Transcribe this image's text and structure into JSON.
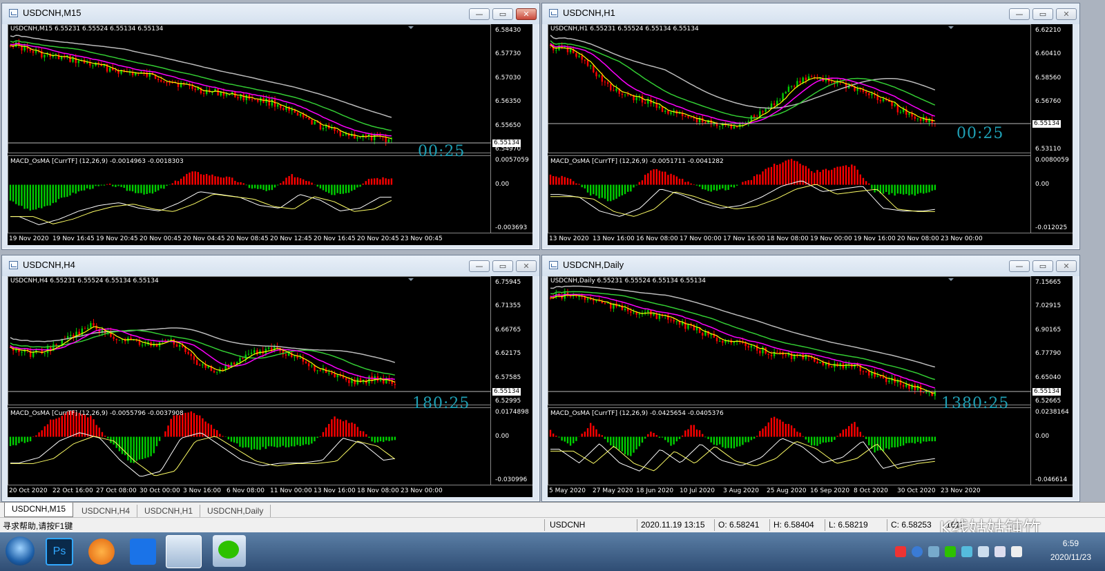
{
  "windows": [
    {
      "id": "m15",
      "title": "USDCNH,M15",
      "info": "USDCNH,M15  6.55231 6.55524 6.55134 6.55134",
      "price_labels": [
        "6.58430",
        "6.57730",
        "6.57030",
        "6.56350",
        "6.55650",
        "6.54970"
      ],
      "current_price": "6.55134",
      "timer": "00:25",
      "indicator_info": "MACD_OsMA [CurrTF] (12,26,9) -0.0014963 -0.0018303",
      "indicator_labels": [
        "0.0057059",
        "0.00",
        "-0.003693"
      ],
      "time_labels": [
        "19 Nov 2020",
        "19 Nov 16:45",
        "19 Nov 20:45",
        "20 Nov 00:45",
        "20 Nov 04:45",
        "20 Nov 08:45",
        "20 Nov 12:45",
        "20 Nov 16:45",
        "20 Nov 20:45",
        "23 Nov 00:45"
      ],
      "close_style": "red"
    },
    {
      "id": "h1",
      "title": "USDCNH,H1",
      "info": "USDCNH,H1  6.55231 6.55524 6.55134 6.55134",
      "price_labels": [
        "6.62210",
        "6.60410",
        "6.58560",
        "6.56760",
        "6.54910",
        "6.53110"
      ],
      "current_price": "6.55134",
      "timer": "00:25",
      "indicator_info": "MACD_OsMA [CurrTF] (12,26,9) -0.0051711 -0.0041282",
      "indicator_labels": [
        "0.0080059",
        "0.00",
        "-0.012025"
      ],
      "time_labels": [
        "13 Nov 2020",
        "13 Nov 16:00",
        "16 Nov 08:00",
        "17 Nov 00:00",
        "17 Nov 16:00",
        "18 Nov 08:00",
        "19 Nov 00:00",
        "19 Nov 16:00",
        "20 Nov 08:00",
        "23 Nov 00:00"
      ],
      "close_style": "gray"
    },
    {
      "id": "h4",
      "title": "USDCNH,H4",
      "info": "USDCNH,H4  6.55231 6.55524 6.55134 6.55134",
      "price_labels": [
        "6.75945",
        "6.71355",
        "6.66765",
        "6.62175",
        "6.57585",
        "6.52995"
      ],
      "current_price": "6.55134",
      "timer": "180:25",
      "indicator_info": "MACD_OsMA [CurrTF] (12,26,9) -0.0055796 -0.0037908",
      "indicator_labels": [
        "0.0174898",
        "0.00",
        "-0.030996"
      ],
      "time_labels": [
        "20 Oct 2020",
        "22 Oct 16:00",
        "27 Oct 08:00",
        "30 Oct 00:00",
        "3 Nov 16:00",
        "6 Nov 08:00",
        "11 Nov 00:00",
        "13 Nov 16:00",
        "18 Nov 08:00",
        "23 Nov 00:00"
      ],
      "close_style": "gray"
    },
    {
      "id": "d1",
      "title": "USDCNH,Daily",
      "info": "USDCNH,Daily  6.55231 6.55524 6.55134 6.55134",
      "price_labels": [
        "7.15665",
        "7.02915",
        "6.90165",
        "6.77790",
        "6.65040",
        "6.52665"
      ],
      "current_price": "6.55134",
      "timer": "1380:25",
      "indicator_info": "MACD_OsMA [CurrTF] (12,26,9) -0.0425654 -0.0405376",
      "indicator_labels": [
        "0.0238164",
        "0.00",
        "-0.046614"
      ],
      "time_labels": [
        "5 May 2020",
        "27 May 2020",
        "18 Jun 2020",
        "10 Jul 2020",
        "3 Aug 2020",
        "25 Aug 2020",
        "16 Sep 2020",
        "8 Oct 2020",
        "30 Oct 2020",
        "23 Nov 2020"
      ],
      "close_style": "gray"
    }
  ],
  "tabs": [
    "USDCNH,M15",
    "USDCNH,H4",
    "USDCNH,H1",
    "USDCNH,Daily"
  ],
  "status": {
    "help": "寻求帮助,请按F1键",
    "symbol": "USDCNH",
    "datetime": "2020.11.19 13:15",
    "open": "O: 6.58241",
    "high": "H: 6.58404",
    "low": "L: 6.58219",
    "close": "C: 6.58253",
    "volume": "1611"
  },
  "taskbar": {
    "time": "6:59",
    "date": "2020/11/23"
  },
  "watermark": "K线姑姑钝竹",
  "colors": {
    "bull": "#00d000",
    "bear": "#ff0000",
    "ma_fast": "#ffff00",
    "ma_mid": "#ff00ff",
    "ma_slow": "#33cc33",
    "ma_long": "#bbbbbb",
    "timer": "#1fa0b5"
  }
}
